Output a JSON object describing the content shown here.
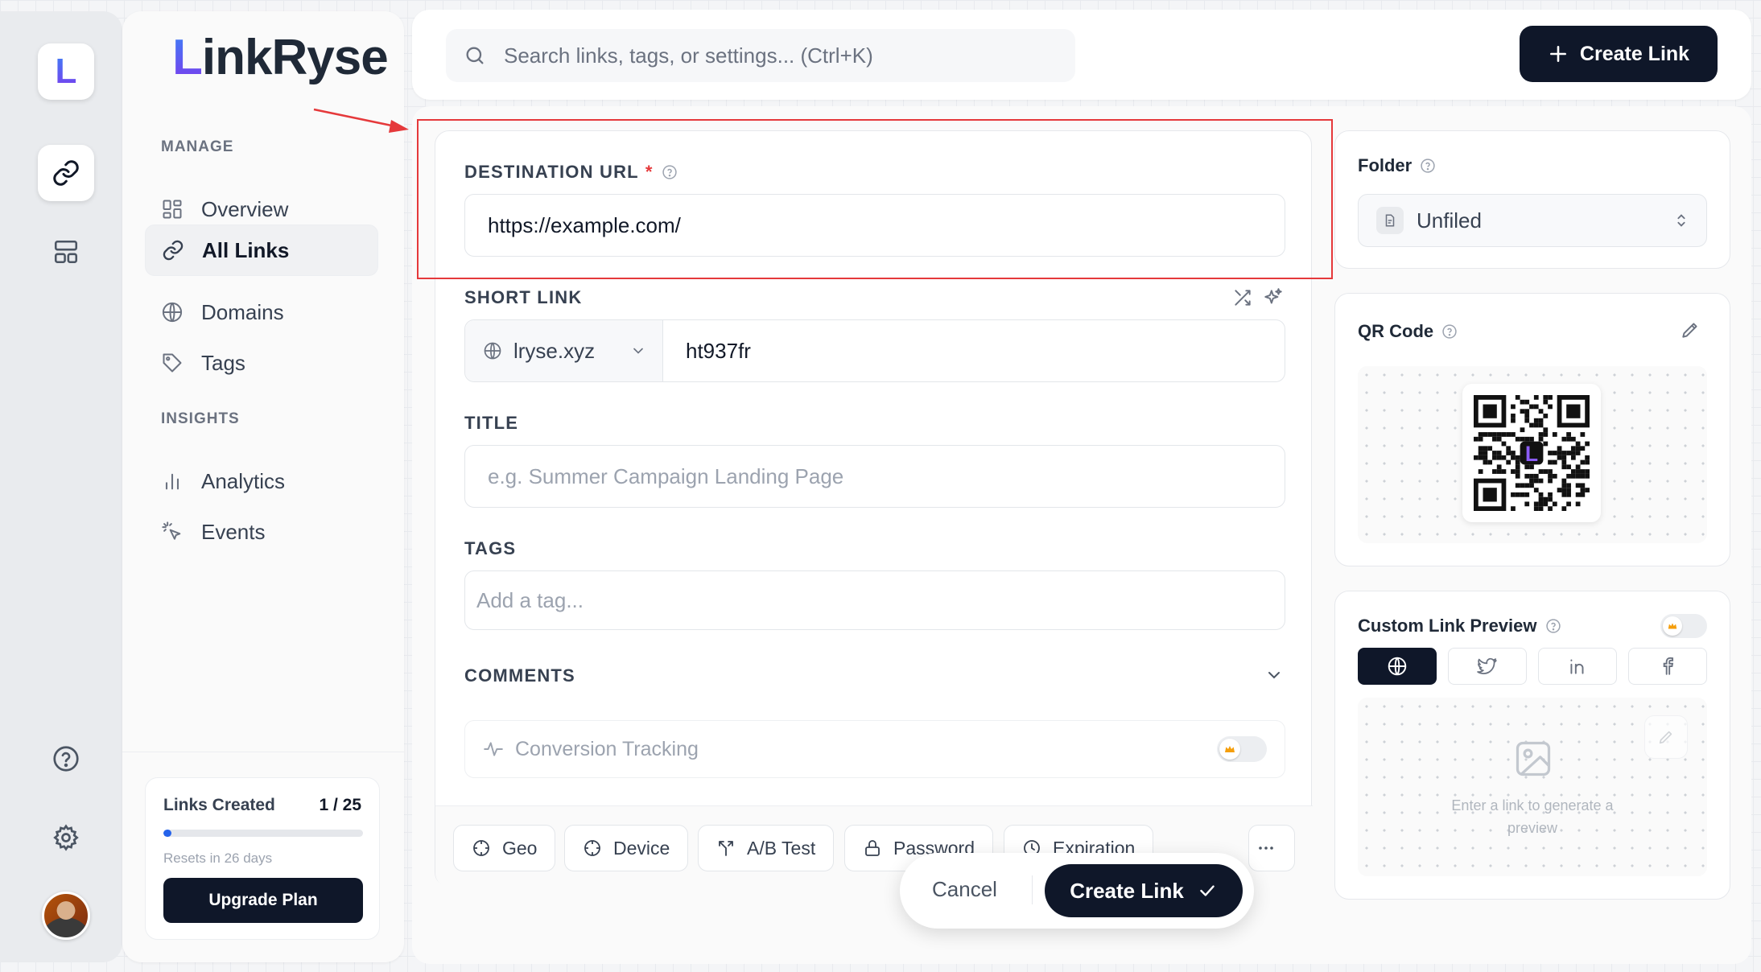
{
  "app": {
    "brand": "LinkRyse",
    "brand_initial": "L",
    "accent": "#0f1729",
    "brand_gradient": [
      "#3b82f6",
      "#7c3aed"
    ],
    "highlight": "#e5393b"
  },
  "rail": {
    "items": [
      {
        "icon": "logo-icon"
      },
      {
        "icon": "link-icon"
      },
      {
        "icon": "layout-icon"
      },
      {
        "icon": "help-icon"
      },
      {
        "icon": "gear-icon"
      },
      {
        "icon": "avatar"
      }
    ]
  },
  "sidebar": {
    "manage_label": "MANAGE",
    "manage_items": [
      {
        "label": "Overview",
        "icon": "grid-icon"
      },
      {
        "label": "All Links",
        "icon": "link-icon",
        "active": true
      },
      {
        "label": "Domains",
        "icon": "globe-icon"
      },
      {
        "label": "Tags",
        "icon": "tag-icon"
      }
    ],
    "insights_label": "INSIGHTS",
    "insights_items": [
      {
        "label": "Analytics",
        "icon": "bar-chart-icon"
      },
      {
        "label": "Events",
        "icon": "cursor-click-icon"
      }
    ],
    "usage": {
      "label": "Links Created",
      "count": "1 / 25",
      "progress": 0.04,
      "resets": "Resets in 26 days",
      "upgrade": "Upgrade Plan"
    }
  },
  "header": {
    "search_placeholder": "Search links, tags, or settings... (Ctrl+K)",
    "create_label": "Create Link"
  },
  "form": {
    "destination_label": "DESTINATION URL",
    "required_mark": "*",
    "destination_value": "https://example.com/",
    "short_link_label": "SHORT LINK",
    "domain": "lryse.xyz",
    "slug": "ht937fr",
    "title_label": "TITLE",
    "title_placeholder": "e.g. Summer Campaign Landing Page",
    "tags_label": "TAGS",
    "tags_placeholder": "Add a tag...",
    "comments_label": "COMMENTS",
    "conversion_label": "Conversion Tracking",
    "options": [
      "Geo",
      "Device",
      "A/B Test",
      "Password",
      "Expiration"
    ]
  },
  "folder": {
    "label": "Folder",
    "value": "Unfiled"
  },
  "qr": {
    "label": "QR Code"
  },
  "preview": {
    "label": "Custom Link Preview",
    "hint": "Enter a link to generate a preview",
    "platforms": [
      "globe-icon",
      "twitter-icon",
      "linkedin-icon",
      "facebook-icon"
    ]
  },
  "footer": {
    "cancel": "Cancel",
    "create": "Create Link"
  }
}
